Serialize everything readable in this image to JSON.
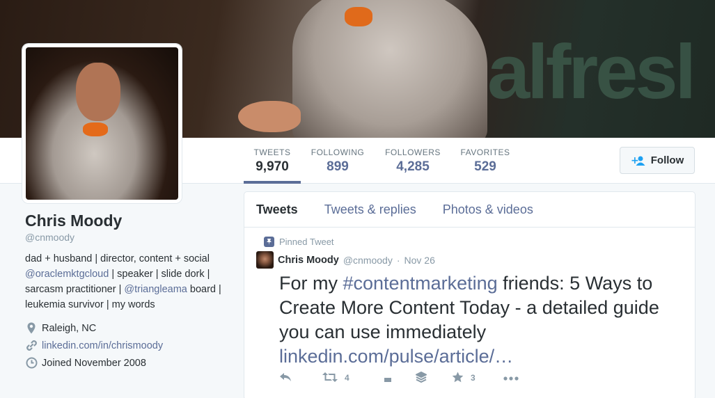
{
  "banner": {
    "background_text": "alfresl"
  },
  "stats": [
    {
      "label": "TWEETS",
      "value": "9,970",
      "active": true
    },
    {
      "label": "FOLLOWING",
      "value": "899"
    },
    {
      "label": "FOLLOWERS",
      "value": "4,285"
    },
    {
      "label": "FAVORITES",
      "value": "529"
    }
  ],
  "follow_button": {
    "label": "Follow"
  },
  "profile": {
    "name": "Chris Moody",
    "handle": "@cnmoody",
    "bio": {
      "part1": "dad + husband | director, content + social ",
      "mention1": "@oraclemktgcloud",
      "part2": " | speaker | slide dork | sarcasm practitioner | ",
      "mention2": "@triangleama",
      "part3": " board | leukemia survivor | my words"
    },
    "location": "Raleigh, NC",
    "website": "linkedin.com/in/chrismoody",
    "joined": "Joined November 2008"
  },
  "tabs": [
    "Tweets",
    "Tweets & replies",
    "Photos & videos"
  ],
  "tweet": {
    "pinned_label": "Pinned Tweet",
    "name": "Chris Moody",
    "handle": "@cnmoody",
    "separator": "·",
    "date": "Nov 26",
    "text_before": "For my ",
    "hashtag": "#contentmarketing",
    "text_after": " friends: 5 Ways to Create More Content Today - a detailed guide you can use immediately ",
    "link": "linkedin.com/pulse/article/…",
    "retweets": "4",
    "favorites": "3"
  },
  "colors": {
    "link": "#5b6d97",
    "text": "#292f33",
    "muted": "#8899a6",
    "background": "#f5f8fa"
  }
}
